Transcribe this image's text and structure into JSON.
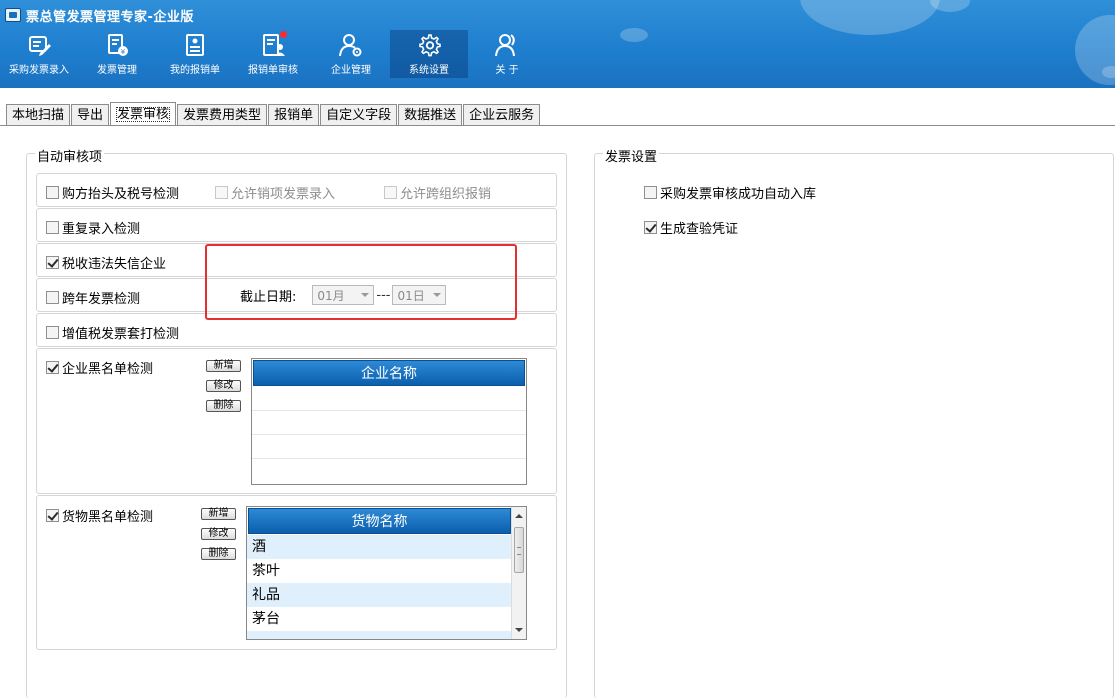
{
  "app": {
    "title": "票总管发票管理专家-企业版"
  },
  "toolbar": [
    {
      "label": "采购发票录入",
      "icon": "invoice-entry-icon"
    },
    {
      "label": "发票管理",
      "icon": "invoice-manage-icon"
    },
    {
      "label": "我的报销单",
      "icon": "reimbursement-icon"
    },
    {
      "label": "报销单审核",
      "icon": "reimbursement-review-icon"
    },
    {
      "label": "企业管理",
      "icon": "enterprise-manage-icon"
    },
    {
      "label": "系统设置",
      "icon": "gear-icon"
    },
    {
      "label": "关 于",
      "icon": "about-icon"
    }
  ],
  "tabs": [
    "本地扫描",
    "导出",
    "发票审核",
    "发票费用类型",
    "报销单",
    "自定义字段",
    "数据推送",
    "企业云服务"
  ],
  "active_tab": "发票审核",
  "auto_review": {
    "legend": "自动审核项",
    "buyer_check": "购方抬头及税号检测",
    "allow_sales_entry": "允许销项发票录入",
    "allow_cross_org": "允许跨组织报销",
    "duplicate_check": "重复录入检测",
    "tax_violation_check": "税收违法失信企业",
    "cross_year_check": "跨年发票检测",
    "deadline_label": "截止日期:",
    "deadline_month": "01月",
    "deadline_sep": "---",
    "deadline_day": "01日",
    "vat_overprint_check": "增值税发票套打检测",
    "company_blacklist": {
      "label": "企业黑名单检测",
      "column": "企业名称",
      "btn_add": "新增",
      "btn_edit": "修改",
      "btn_delete": "删除",
      "rows": []
    },
    "goods_blacklist": {
      "label": "货物黑名单检测",
      "column": "货物名称",
      "btn_add": "新增",
      "btn_edit": "修改",
      "btn_delete": "删除",
      "rows": [
        "酒",
        "茶叶",
        "礼品",
        "茅台"
      ]
    }
  },
  "invoice_settings": {
    "legend": "发票设置",
    "auto_stock": "采购发票审核成功自动入库",
    "gen_voucher": "生成查验凭证"
  },
  "colors": {
    "header": "#1f7fcf",
    "grid_header": "#0b5fad",
    "highlight": "#e53030",
    "alt_row": "#dff0fc"
  }
}
